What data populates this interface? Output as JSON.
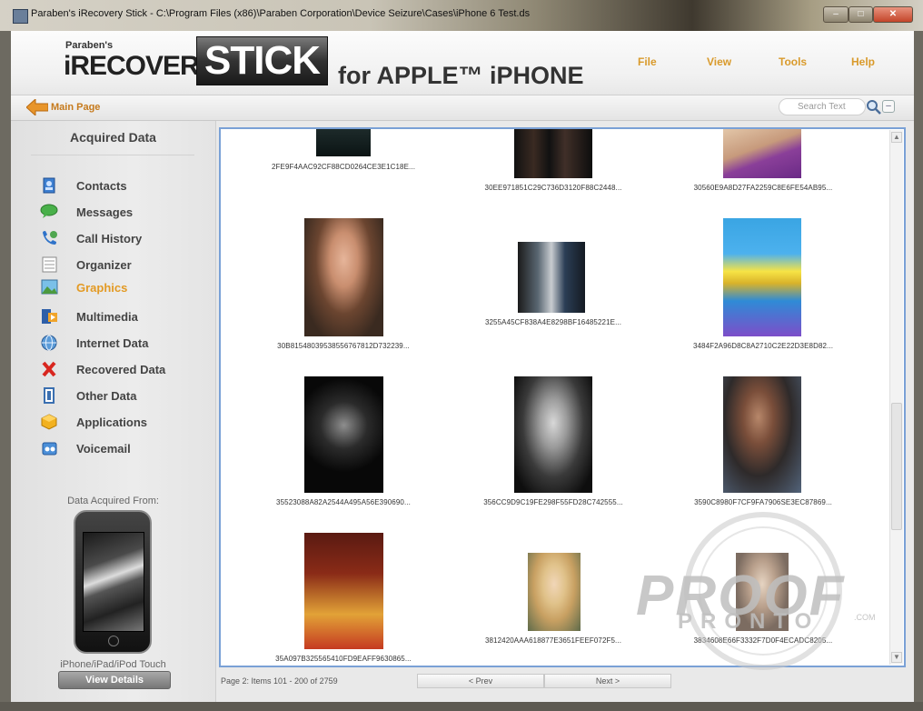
{
  "window": {
    "title": "Paraben's iRecovery Stick - C:\\Program Files (x86)\\Paraben Corporation\\Device Seizure\\Cases\\iPhone 6 Test.ds",
    "minimize": "–",
    "maximize": "□",
    "close": "✕"
  },
  "brand": {
    "company": "Paraben's",
    "product": "iRECOVERY",
    "stick": "STICK",
    "subtitle": "for APPLE™ iPHONE"
  },
  "menu": [
    "File",
    "View",
    "Tools",
    "Help"
  ],
  "nav": {
    "main_page": "Main Page",
    "search_placeholder": "Search Text",
    "clear": "–"
  },
  "sidebar": {
    "title": "Acquired Data",
    "items": [
      {
        "label": "Contacts",
        "icon": "contacts-icon"
      },
      {
        "label": "Messages",
        "icon": "messages-icon"
      },
      {
        "label": "Call History",
        "icon": "call-history-icon"
      },
      {
        "label": "Organizer",
        "icon": "organizer-icon"
      },
      {
        "label": "Graphics",
        "icon": "graphics-icon",
        "active": true
      },
      {
        "label": "Multimedia",
        "icon": "multimedia-icon"
      },
      {
        "label": "Internet Data",
        "icon": "internet-data-icon"
      },
      {
        "label": "Recovered Data",
        "icon": "recovered-data-icon"
      },
      {
        "label": "Other Data",
        "icon": "other-data-icon"
      },
      {
        "label": "Applications",
        "icon": "applications-icon"
      },
      {
        "label": "Voicemail",
        "icon": "voicemail-icon"
      }
    ],
    "acquired_from": "Data Acquired From:",
    "device_type": "iPhone/iPad/iPod Touch",
    "view_details": "View Details"
  },
  "gallery": {
    "captions": [
      "2FE9F4AAC92CF88CD0264CE3E1C18E...",
      "30EE971851C29C736D3120F88C2448...",
      "30560E9A8D27FA2259C8E6FE54AB95...",
      "30B81548039538556767812D732239...",
      "3255A45CF838A4E8298BF16485221E...",
      "3484F2A96D8C8A2710C2E22D3E8D82...",
      "35523088A82A2544A495A56E390690...",
      "356CC9D9C19FE298F55FD28C742555...",
      "3590C8980F7CF9FA7906SE3EC87869...",
      "35A097B325565410FD9EAFF9630865...",
      "3812420AAA618877E3651FEEF072F5...",
      "3834608E66F3332F7D0F4ECADC8205..."
    ]
  },
  "status": {
    "page_info": "Page 2: Items 101 - 200 of 2759",
    "prev": "< Prev",
    "next": "Next >"
  },
  "watermark": {
    "line1": "PROOF",
    "line2": "PRONTO",
    "com": ".COM"
  },
  "colors": {
    "accent_orange": "#e39a24",
    "gallery_border": "#7aa1d6"
  }
}
